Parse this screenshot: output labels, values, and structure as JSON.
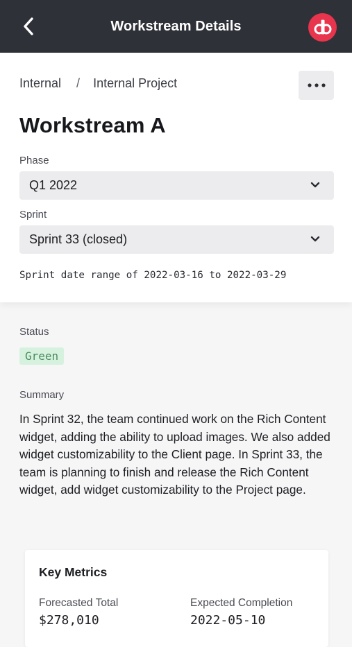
{
  "header": {
    "title": "Workstream Details",
    "back_icon": "chevron-left-icon",
    "logo_text": "db",
    "logo_color": "#e8344c",
    "bar_color": "#2f3138"
  },
  "breadcrumb": {
    "items": [
      "Internal",
      "Internal Project"
    ],
    "separator": "/"
  },
  "more_icon": "ellipsis-icon",
  "page_title": "Workstream A",
  "phase": {
    "label": "Phase",
    "value": "Q1 2022"
  },
  "sprint": {
    "label": "Sprint",
    "value": "Sprint 33 (closed)",
    "date_range_text": "Sprint date range of 2022-03-16 to 2022-03-29"
  },
  "status": {
    "label": "Status",
    "value": "Green",
    "badge_bg": "#d6f2df",
    "badge_fg": "#4a8a5e"
  },
  "summary": {
    "label": "Summary",
    "text": "In Sprint 32, the team continued work on the Rich Content widget, adding the ability to upload images. We also added widget customizability to the Client page. In Sprint 33, the team is planning to finish and release the Rich Content widget, add widget customizability to the Project page."
  },
  "key_metrics": {
    "title": "Key Metrics",
    "metrics": [
      {
        "label": "Forecasted Total",
        "value": "$278,010"
      },
      {
        "label": "Expected Completion",
        "value": "2022-05-10"
      }
    ]
  }
}
